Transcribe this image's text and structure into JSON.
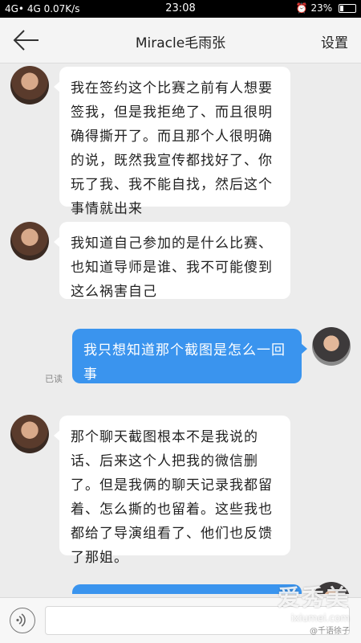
{
  "status_bar": {
    "left": "4G• 4G 0.07K/s",
    "time": "23:08",
    "battery": "23%",
    "battery_level": 0.23
  },
  "header": {
    "title": "Miracle毛雨张",
    "settings_label": "设置"
  },
  "messages": [
    {
      "side": "left",
      "text": "我在签约这个比赛之前有人想要签我，但是我拒绝了、而且很明确得撕开了。而且那个人很明确的说，既然我宣传都找好了、你玩了我、我不能自找，然后这个事情就出来"
    },
    {
      "side": "left",
      "text": "我知道自己参加的是什么比赛、也知道导师是谁、我不可能傻到这么祸害自己"
    },
    {
      "side": "right",
      "text": "我只想知道那个截图是怎么一回事",
      "read": "已读"
    },
    {
      "side": "left",
      "text": "那个聊天截图根本不是我说的话、后来这个人把我的微信删了。但是我俩的聊天记录我都留着、怎么撕的也留着。这些我也都给了导演组看了、他们也反馈了那姐。"
    },
    {
      "side": "right",
      "text": ""
    }
  ],
  "input": {
    "value": "",
    "placeholder": ""
  },
  "watermark": {
    "main": "爱秀美",
    "url": "ixiumei.com",
    "weibo": "@千语徐子"
  },
  "colors": {
    "accent": "#3a94ee",
    "background": "#ececec"
  }
}
